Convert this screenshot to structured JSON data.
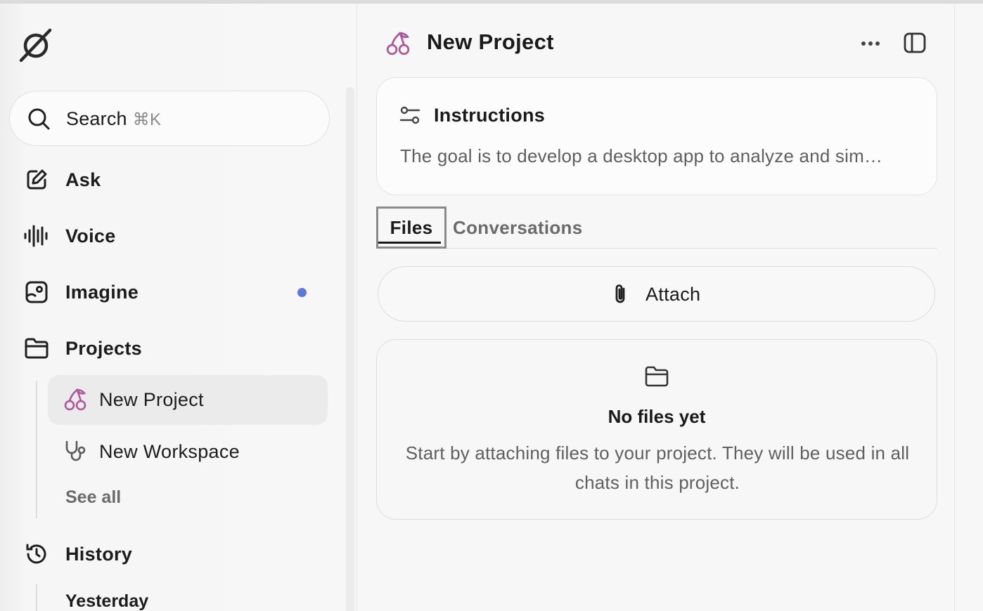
{
  "sidebar": {
    "search": {
      "label": "Search",
      "shortcut": "⌘K"
    },
    "nav": {
      "ask": "Ask",
      "voice": "Voice",
      "imagine": "Imagine",
      "projects": "Projects",
      "history": "History"
    },
    "projects": [
      {
        "label": "New Project",
        "icon": "cherry-icon"
      },
      {
        "label": "New Workspace",
        "icon": "stethoscope-icon"
      }
    ],
    "see_all": "See all",
    "history_group": "Yesterday",
    "imagine_badge_color": "#5a78e0"
  },
  "project": {
    "title": "New Project",
    "accent_color": "#b0569c",
    "instructions": {
      "title": "Instructions",
      "text": "The goal is to develop a desktop app to analyze and sim…"
    },
    "tabs": [
      "Files",
      "Conversations"
    ],
    "active_tab": "Files",
    "attach_label": "Attach",
    "empty_state": {
      "title": "No files yet",
      "text": "Start by attaching files to your project. They will be used in all chats in this project."
    }
  }
}
